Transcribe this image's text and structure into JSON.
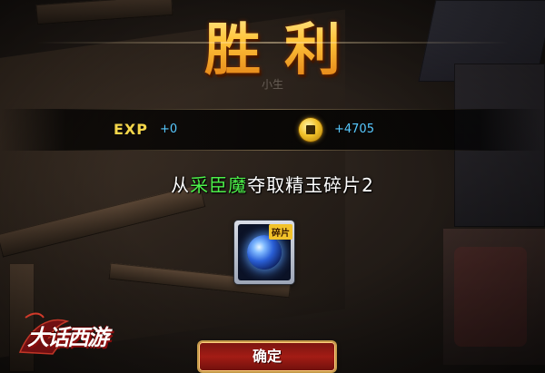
{
  "result": {
    "title": "胜利",
    "subtitle": "小生"
  },
  "rewards": {
    "exp_label": "EXP",
    "exp_value": "+0",
    "coin_icon": "copper-coin-icon",
    "coin_value": "+4705"
  },
  "loot": {
    "prefix": "从",
    "boss": "采臣魔",
    "suffix": "夺取精玉碎片2",
    "boss_color": "#4df04a"
  },
  "item": {
    "badge": "碎片",
    "icon": "jade-orb-icon"
  },
  "logo": {
    "text": "大话西游"
  },
  "buttons": {
    "confirm": "确定"
  },
  "colors": {
    "title_gold": "#ffb21e",
    "exp_label": "#f4d64a",
    "value_blue": "#57c9ff",
    "button_red": "#a31c15"
  }
}
